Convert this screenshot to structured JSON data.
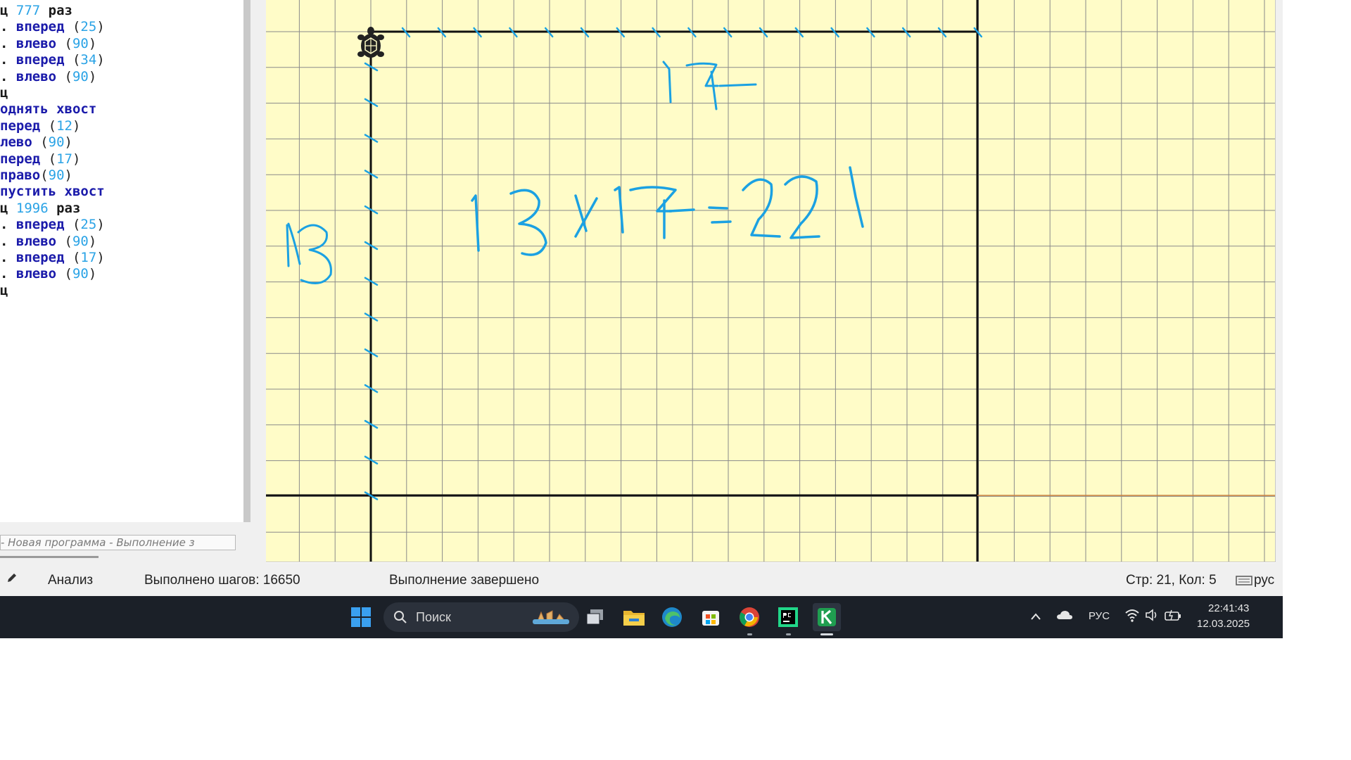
{
  "editor": {
    "lines": [
      {
        "parts": [
          {
            "t": "ц ",
            "c": "kw"
          },
          {
            "t": "777",
            "c": "num"
          },
          {
            "t": " раз",
            "c": "kw"
          }
        ]
      },
      {
        "parts": [
          {
            "t": ". ",
            "c": "kw"
          },
          {
            "t": "вперед",
            "c": "blue"
          },
          {
            "t": " (",
            "c": "paren"
          },
          {
            "t": "25",
            "c": "num"
          },
          {
            "t": ")",
            "c": "paren"
          }
        ]
      },
      {
        "parts": [
          {
            "t": ". ",
            "c": "kw"
          },
          {
            "t": "влево",
            "c": "blue"
          },
          {
            "t": " (",
            "c": "paren"
          },
          {
            "t": "90",
            "c": "num"
          },
          {
            "t": ")",
            "c": "paren"
          }
        ]
      },
      {
        "parts": [
          {
            "t": ". ",
            "c": "kw"
          },
          {
            "t": "вперед",
            "c": "blue"
          },
          {
            "t": " (",
            "c": "paren"
          },
          {
            "t": "34",
            "c": "num"
          },
          {
            "t": ")",
            "c": "paren"
          }
        ]
      },
      {
        "parts": [
          {
            "t": ". ",
            "c": "kw"
          },
          {
            "t": "влево",
            "c": "blue"
          },
          {
            "t": " (",
            "c": "paren"
          },
          {
            "t": "90",
            "c": "num"
          },
          {
            "t": ")",
            "c": "paren"
          }
        ]
      },
      {
        "parts": [
          {
            "t": "ц",
            "c": "kw"
          }
        ]
      },
      {
        "parts": [
          {
            "t": "однять хвост",
            "c": "blue"
          }
        ]
      },
      {
        "parts": [
          {
            "t": "перед",
            "c": "blue"
          },
          {
            "t": " (",
            "c": "paren"
          },
          {
            "t": "12",
            "c": "num"
          },
          {
            "t": ")",
            "c": "paren"
          }
        ]
      },
      {
        "parts": [
          {
            "t": "лево",
            "c": "blue"
          },
          {
            "t": " (",
            "c": "paren"
          },
          {
            "t": "90",
            "c": "num"
          },
          {
            "t": ")",
            "c": "paren"
          }
        ]
      },
      {
        "parts": [
          {
            "t": "перед",
            "c": "blue"
          },
          {
            "t": " (",
            "c": "paren"
          },
          {
            "t": "17",
            "c": "num"
          },
          {
            "t": ")",
            "c": "paren"
          }
        ]
      },
      {
        "parts": [
          {
            "t": "право",
            "c": "blue"
          },
          {
            "t": "(",
            "c": "paren"
          },
          {
            "t": "90",
            "c": "num"
          },
          {
            "t": ")",
            "c": "paren"
          }
        ]
      },
      {
        "parts": [
          {
            "t": "пустить хвост",
            "c": "blue"
          }
        ]
      },
      {
        "parts": [
          {
            "t": "ц ",
            "c": "kw"
          },
          {
            "t": "1996",
            "c": "num"
          },
          {
            "t": " раз",
            "c": "kw"
          }
        ]
      },
      {
        "parts": [
          {
            "t": ". ",
            "c": "kw"
          },
          {
            "t": "вперед",
            "c": "blue"
          },
          {
            "t": " (",
            "c": "paren"
          },
          {
            "t": "25",
            "c": "num"
          },
          {
            "t": ")",
            "c": "paren"
          }
        ]
      },
      {
        "parts": [
          {
            "t": ". ",
            "c": "kw"
          },
          {
            "t": "влево",
            "c": "blue"
          },
          {
            "t": " (",
            "c": "paren"
          },
          {
            "t": "90",
            "c": "num"
          },
          {
            "t": ")",
            "c": "paren"
          }
        ]
      },
      {
        "parts": [
          {
            "t": ". ",
            "c": "kw"
          },
          {
            "t": "вперед",
            "c": "blue"
          },
          {
            "t": " (",
            "c": "paren"
          },
          {
            "t": "17",
            "c": "num"
          },
          {
            "t": ")",
            "c": "paren"
          }
        ]
      },
      {
        "parts": [
          {
            "t": ". ",
            "c": "kw"
          },
          {
            "t": "влево",
            "c": "blue"
          },
          {
            "t": " (",
            "c": "paren"
          },
          {
            "t": "90",
            "c": "num"
          },
          {
            "t": ")",
            "c": "paren"
          }
        ]
      },
      {
        "parts": [
          {
            "t": "ц",
            "c": "kw"
          }
        ]
      }
    ],
    "tab_text": "- Новая программа - Выполнение з"
  },
  "canvas": {
    "background": "#fffcc8",
    "grid_color": "#8a8a8a",
    "ink_color": "#1ba1e2",
    "annotations": [
      "17",
      "13",
      "13×17=221"
    ]
  },
  "status": {
    "mode": "Анализ",
    "steps": "Выполнено шагов: 16650",
    "state": "Выполнение завершено",
    "position": "Стр: 21, Кол: 5",
    "lang": "рус"
  },
  "taskbar": {
    "search_placeholder": "Поиск",
    "lang": "РУС",
    "time": "22:41:43",
    "date": "12.03.2025"
  }
}
